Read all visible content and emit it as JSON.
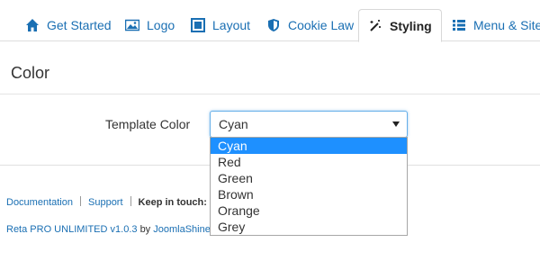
{
  "tabs": [
    {
      "label": "Get Started",
      "icon": "home-icon"
    },
    {
      "label": "Logo",
      "icon": "image-icon"
    },
    {
      "label": "Layout",
      "icon": "layout-icon"
    },
    {
      "label": "Cookie Law",
      "icon": "shield-icon"
    },
    {
      "label": "Styling",
      "icon": "magic-wand-icon",
      "active": true
    },
    {
      "label": "Menu & Site",
      "icon": "list-icon"
    }
  ],
  "section": {
    "title": "Color"
  },
  "template_color": {
    "label": "Template Color",
    "selected": "Cyan",
    "options": [
      "Cyan",
      "Red",
      "Green",
      "Brown",
      "Orange",
      "Grey"
    ]
  },
  "footer": {
    "documentation": "Documentation",
    "support": "Support",
    "keep_in_touch": "Keep in touch:",
    "product": "Reta PRO UNLIMITED v1.0.3",
    "by": "by",
    "vendor": "JoomlaShine.c"
  },
  "colors": {
    "link": "#1a6fb3",
    "selected_option": "#1e90ff",
    "focus_border": "#66afe9"
  }
}
